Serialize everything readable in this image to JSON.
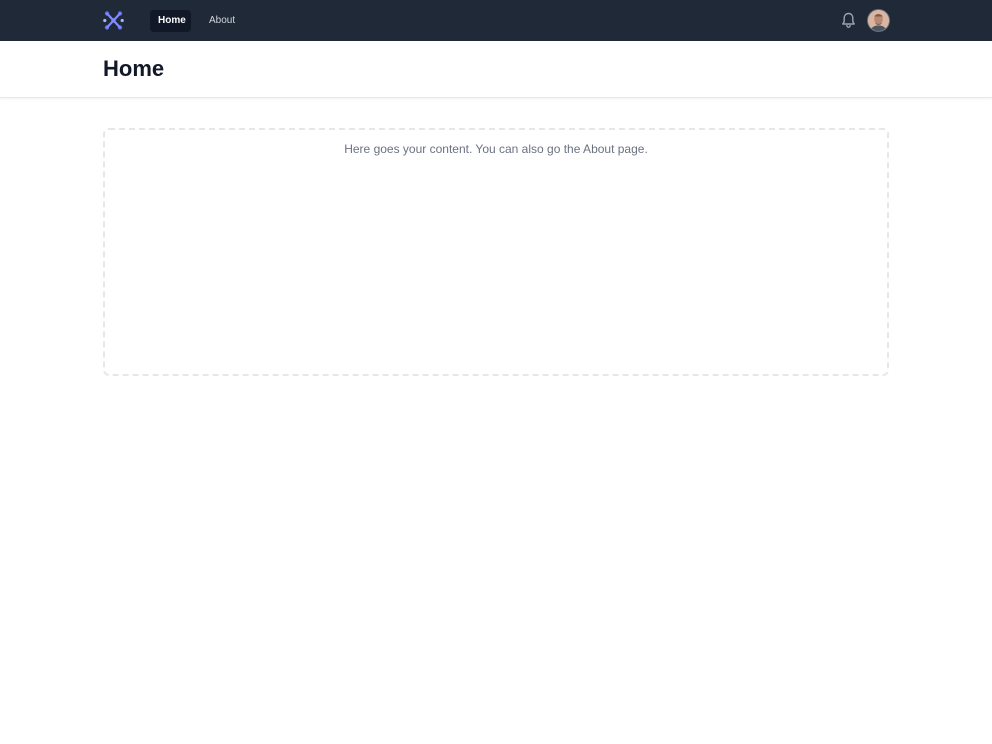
{
  "nav": {
    "links": [
      {
        "label": "Home",
        "active": true
      },
      {
        "label": "About",
        "active": false
      }
    ],
    "logo_icon": "logo-icon",
    "bell_icon": "bell-icon",
    "avatar": "user-avatar"
  },
  "header": {
    "title": "Home"
  },
  "main": {
    "placeholder_text": "Here goes your content. You can also go the About page."
  },
  "colors": {
    "navbar": "#1f2937",
    "active_link_bg": "#111827",
    "logo_accent": "#6366f1",
    "dashed_border": "#e5e7eb",
    "muted_text": "#6b7280"
  }
}
